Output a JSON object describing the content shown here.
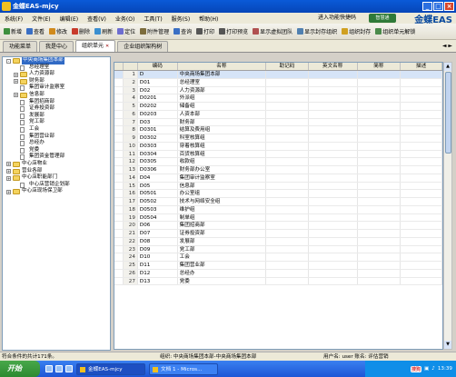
{
  "window": {
    "title": "金蝶EAS-mjcy"
  },
  "menu": {
    "items": [
      "系统(F)",
      "文件(E)",
      "编辑(E)",
      "查看(V)",
      "业务(O)",
      "工具(T)",
      "服务(S)",
      "帮助(H)"
    ],
    "portal": "进入功能快捷码",
    "hand": "智慧通",
    "logo": "金蝶EAS"
  },
  "toolbar": {
    "items": [
      "新增",
      "查看",
      "修改",
      "删除",
      "刷新",
      "定位",
      "附件管理",
      "查询",
      "打印",
      "打印预览",
      "显示虚拟团队",
      "显示封存组织",
      "组织封存",
      "组织单元解锁"
    ]
  },
  "tabs": [
    {
      "label": "功能菜单"
    },
    {
      "label": "我是中心"
    },
    {
      "label": "组织单元"
    },
    {
      "label": "企业组织架构树"
    }
  ],
  "tabnav": "◄ ►",
  "tree": [
    {
      "label": "中央商场集团本部",
      "level": 0,
      "kind": "folder",
      "exp": "-"
    },
    {
      "label": "总经理室",
      "level": 1,
      "kind": "doc"
    },
    {
      "label": "人力资源部",
      "level": 1,
      "kind": "folder",
      "exp": "+"
    },
    {
      "label": "财务部",
      "level": 1,
      "kind": "folder",
      "exp": "+"
    },
    {
      "label": "集团审计监察室",
      "level": 1,
      "kind": "doc"
    },
    {
      "label": "信息部",
      "level": 1,
      "kind": "folder",
      "exp": "+"
    },
    {
      "label": "集团招商部",
      "level": 1,
      "kind": "doc"
    },
    {
      "label": "证券投资部",
      "level": 1,
      "kind": "doc"
    },
    {
      "label": "发展部",
      "level": 1,
      "kind": "doc"
    },
    {
      "label": "党工部",
      "level": 1,
      "kind": "doc"
    },
    {
      "label": "工会",
      "level": 1,
      "kind": "doc"
    },
    {
      "label": "集团营业部",
      "level": 1,
      "kind": "doc"
    },
    {
      "label": "总经办",
      "level": 1,
      "kind": "doc"
    },
    {
      "label": "党委",
      "level": 1,
      "kind": "doc"
    },
    {
      "label": "集团资金管理部",
      "level": 1,
      "kind": "doc"
    },
    {
      "label": "中心店物业",
      "level": 0,
      "kind": "folder",
      "exp": "+"
    },
    {
      "label": "营业各部",
      "level": 0,
      "kind": "folder",
      "exp": "+"
    },
    {
      "label": "中心店职能部门",
      "level": 0,
      "kind": "folder",
      "exp": "+"
    },
    {
      "label": "中心店营销企划部",
      "level": 1,
      "kind": "doc"
    },
    {
      "label": "中心店现场保卫部",
      "level": 0,
      "kind": "folder",
      "exp": "+"
    }
  ],
  "grid": {
    "headers": [
      "",
      "编码",
      "名称",
      "助记码",
      "英文名称",
      "简称",
      "描述"
    ],
    "rows": [
      [
        "1",
        "D",
        "中央商场集团本部"
      ],
      [
        "2",
        "D01",
        "总经理室"
      ],
      [
        "3",
        "D02",
        "人力资源部"
      ],
      [
        "4",
        "D0201",
        "外派组"
      ],
      [
        "5",
        "D0202",
        "储备组"
      ],
      [
        "6",
        "D0203",
        "人资本部"
      ],
      [
        "7",
        "D03",
        "财务部"
      ],
      [
        "8",
        "D0301",
        "结算及费用组"
      ],
      [
        "9",
        "D0302",
        "科室核算组"
      ],
      [
        "10",
        "D0303",
        "穿着核算组"
      ],
      [
        "11",
        "D0304",
        "百货核算组"
      ],
      [
        "12",
        "D0305",
        "收款组"
      ],
      [
        "13",
        "D0306",
        "财务部办公室"
      ],
      [
        "14",
        "D04",
        "集团审计监察室"
      ],
      [
        "15",
        "D05",
        "信息部"
      ],
      [
        "16",
        "D0501",
        "办公室组"
      ],
      [
        "17",
        "D0502",
        "技术与网络安全组"
      ],
      [
        "18",
        "D0503",
        "维护组"
      ],
      [
        "19",
        "D0504",
        "制单组"
      ],
      [
        "20",
        "D06",
        "集团招商部"
      ],
      [
        "21",
        "D07",
        "证券投资部"
      ],
      [
        "22",
        "D08",
        "发展部"
      ],
      [
        "23",
        "D09",
        "党工部"
      ],
      [
        "24",
        "D10",
        "工会"
      ],
      [
        "25",
        "D11",
        "集团营业部"
      ],
      [
        "26",
        "D12",
        "总经办"
      ],
      [
        "27",
        "D13",
        "党委"
      ]
    ]
  },
  "status": {
    "left": "符合条件的共计171条。",
    "center": "组织: 中央商场集团本部-中央商场集团本部",
    "right": "用户名: user 账名: 评估营销"
  },
  "taskbar": {
    "start": "开始",
    "tasks": [
      "金蝶EAS-mjcy",
      "文档 1 - Micros..."
    ],
    "sogou": "搜狗",
    "clock": "13:39"
  },
  "colors": {
    "title": "#0a5ad8",
    "selection": "#316ac5",
    "taskbar": "#1d56d6"
  }
}
